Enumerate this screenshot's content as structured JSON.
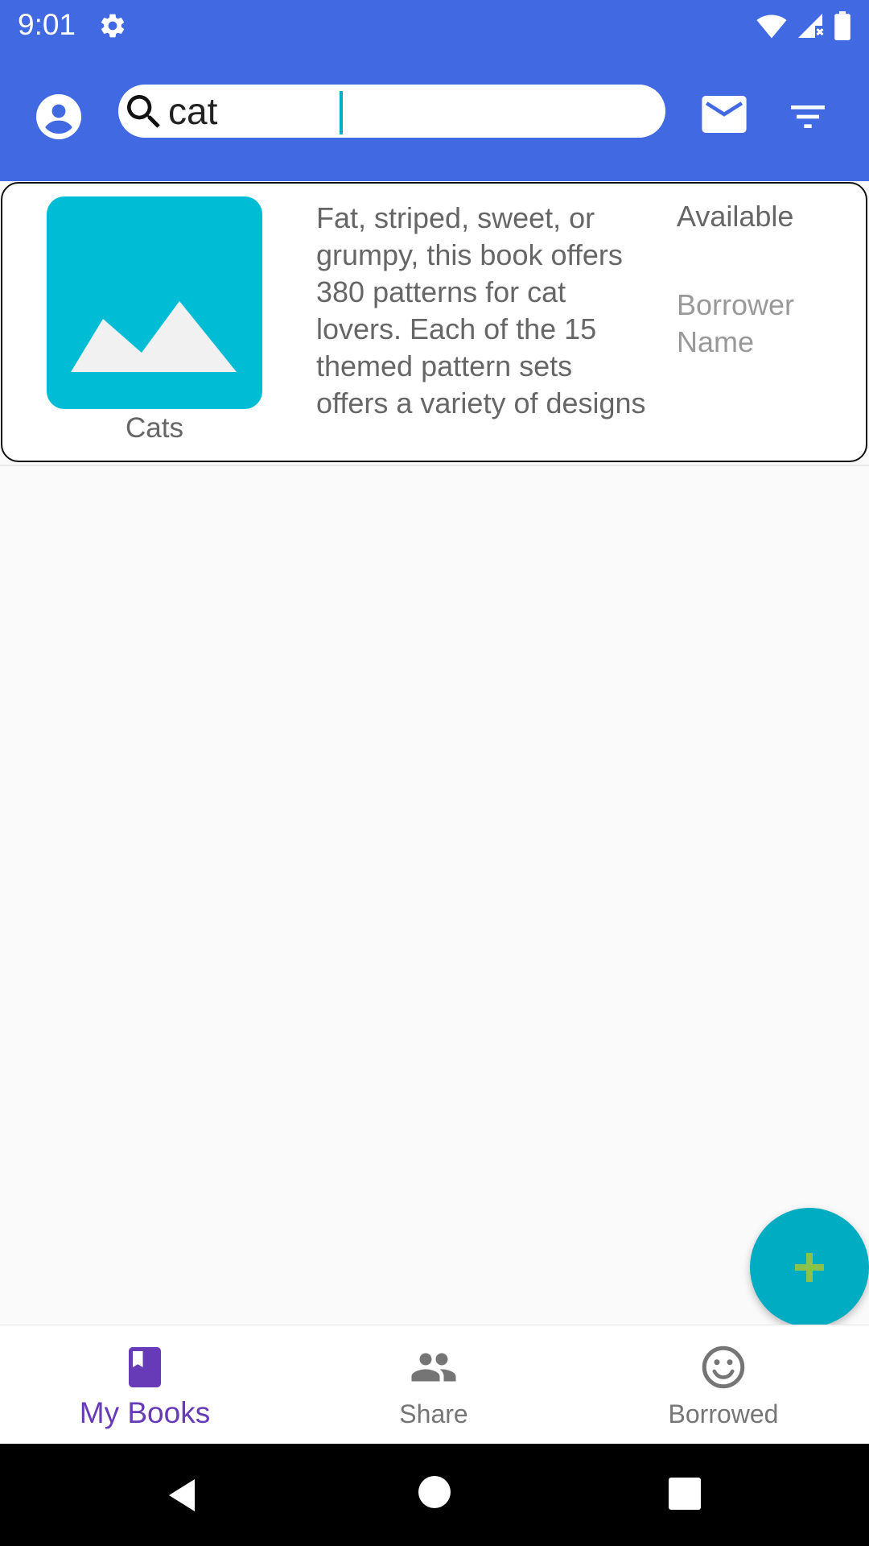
{
  "status_bar": {
    "time": "9:01"
  },
  "search": {
    "value": "cat"
  },
  "book": {
    "title": "Cats",
    "description": "Fat, striped, sweet, or grumpy, this book offers 380 patterns for cat lovers. Each of the 15 themed pattern sets offers a variety of designs",
    "status": "Available",
    "borrower": "Borrower Name"
  },
  "bottom_nav": {
    "items": [
      {
        "label": "My Books",
        "icon": "book-icon",
        "active": true
      },
      {
        "label": "Share",
        "icon": "people-icon",
        "active": false
      },
      {
        "label": "Borrowed",
        "icon": "smiley-icon",
        "active": false
      }
    ]
  },
  "colors": {
    "app_bar": "#4169E1",
    "cover": "#00BCD4",
    "fab": "#00ACC1",
    "fab_plus": "#8BC34A",
    "active_nav": "#673AB7"
  },
  "fab": {
    "icon": "plus-icon"
  }
}
